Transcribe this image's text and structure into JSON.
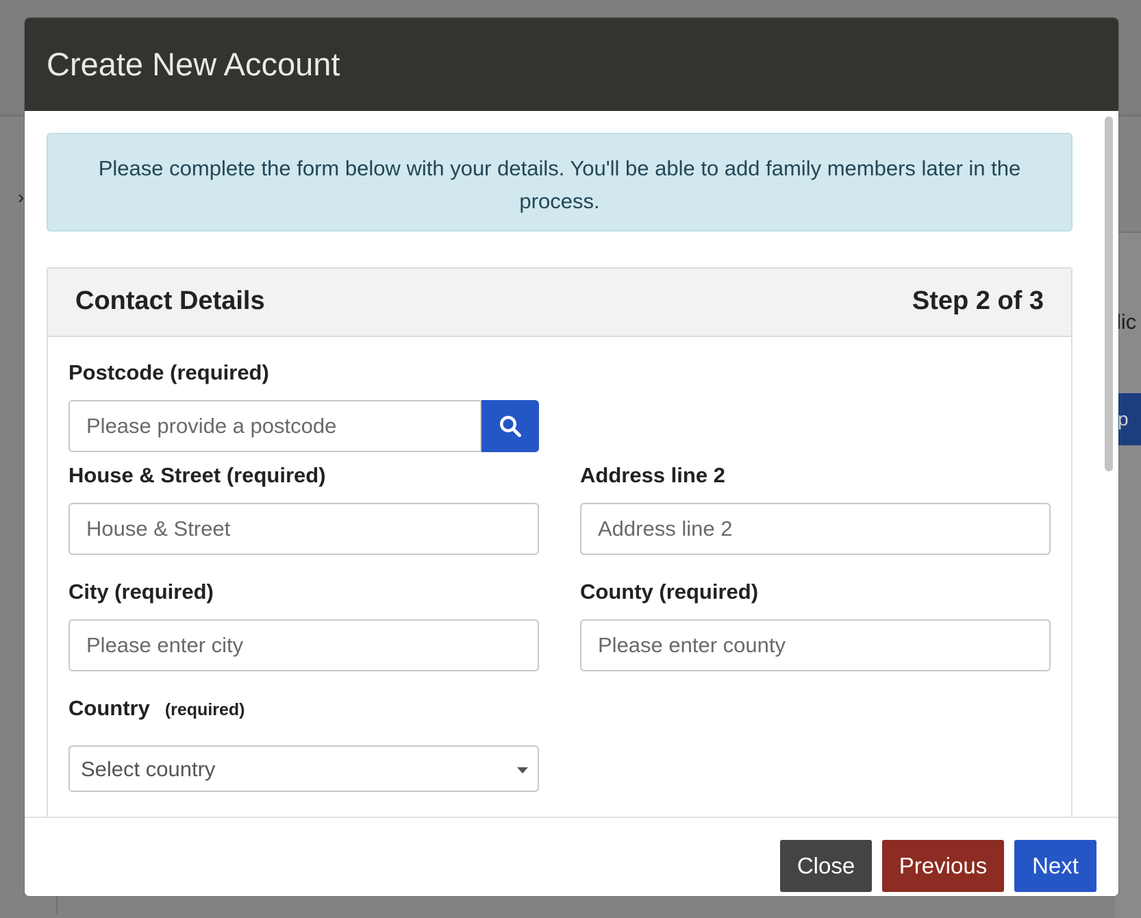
{
  "background": {
    "partial_text": "lic",
    "partial_button": "p"
  },
  "modal": {
    "title": "Create New Account",
    "info_text": "Please complete the form below with your details. You'll be able to add family members later in the process.",
    "section_title": "Contact Details",
    "step_text": "Step 2 of 3"
  },
  "form": {
    "postcode": {
      "label": "Postcode (required)",
      "placeholder": "Please provide a postcode",
      "value": ""
    },
    "house_street": {
      "label": "House & Street (required)",
      "placeholder": "House & Street",
      "value": ""
    },
    "address_line2": {
      "label": "Address line 2",
      "placeholder": "Address line 2",
      "value": ""
    },
    "city": {
      "label": "City (required)",
      "placeholder": "Please enter city",
      "value": ""
    },
    "county": {
      "label": "County (required)",
      "placeholder": "Please enter county",
      "value": ""
    },
    "country": {
      "label": "Country",
      "label_suffix": "(required)",
      "selected": "Select country"
    }
  },
  "footer": {
    "close_label": "Close",
    "previous_label": "Previous",
    "next_label": "Next"
  },
  "icons": {
    "search": "search-icon",
    "caret": "chevron-down-icon"
  },
  "colors": {
    "header_bg": "#343330",
    "primary": "#2556c5",
    "danger": "#8c2c22",
    "secondary": "#444444",
    "info_bg": "#d1e8ef"
  }
}
